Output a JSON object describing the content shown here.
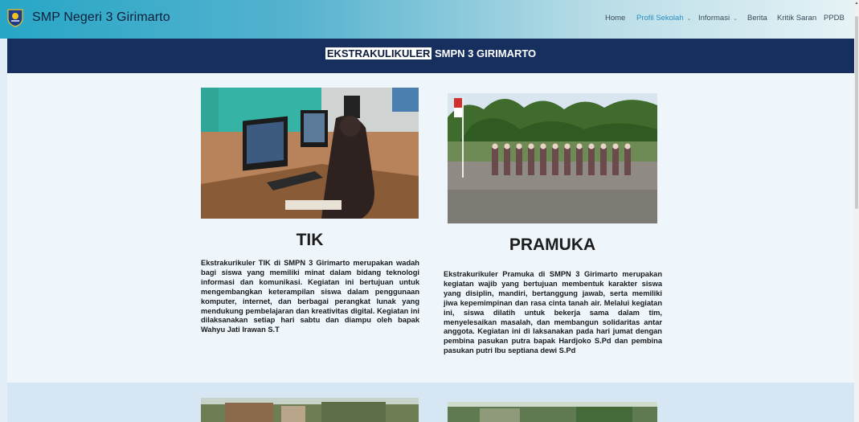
{
  "brand": {
    "name": "SMP Negeri 3 Girimarto",
    "logo_icon": "school-crest-icon"
  },
  "nav": {
    "items": [
      {
        "label": "Home",
        "active": false,
        "dropdown": false
      },
      {
        "label": "Profil Sekolah",
        "active": true,
        "dropdown": true
      },
      {
        "label": "Informasi",
        "active": false,
        "dropdown": true
      },
      {
        "label": "Berita",
        "active": false,
        "dropdown": false
      },
      {
        "label": "Kritik Saran",
        "active": false,
        "dropdown": false
      },
      {
        "label": "PPDB",
        "active": false,
        "dropdown": false
      }
    ]
  },
  "banner": {
    "highlight": "EKSTRAKULIKULER",
    "rest": " SMPN 3 GIRIMARTO"
  },
  "cards": [
    {
      "title": "TIK",
      "image": "students-using-computers-photo",
      "description": "Ekstrakurikuler TIK di SMPN 3 Girimarto merupakan wadah bagi siswa yang memiliki minat dalam bidang teknologi informasi dan komunikasi. Kegiatan ini bertujuan untuk mengembangkan keterampilan siswa dalam penggunaan komputer, internet, dan berbagai perangkat lunak yang mendukung pembelajaran dan kreativitas digital. Kegiatan ini dilaksanakan setiap hari sabtu dan diampu oleh bapak Wahyu Jati Irawan S.T"
    },
    {
      "title": "PRAMUKA",
      "image": "scout-members-lined-up-photo",
      "description": "Ekstrakurikuler Pramuka di SMPN 3 Girimarto merupakan kegiatan wajib yang bertujuan membentuk karakter siswa yang disiplin, mandiri, bertanggung jawab, serta memiliki jiwa kepemimpinan dan rasa cinta tanah air. Melalui kegiatan ini, siswa dilatih untuk bekerja sama dalam tim, menyelesaikan masalah, dan membangun solidaritas antar anggota. Kegiatan ini di laksanakan pada hari jumat dengan pembina pasukan putra bapak Hardjoko S.Pd dan pembina pasukan putri Ibu septiana dewi S.Pd"
    }
  ],
  "next_cards": [
    {
      "image": "school-yard-photo"
    },
    {
      "image": "outdoor-activity-photo"
    }
  ],
  "colors": {
    "nav_start": "#27a6c6",
    "banner_bg": "#172f5e",
    "active_link": "#2b8fc4",
    "section_bg": "#eef6fc"
  }
}
